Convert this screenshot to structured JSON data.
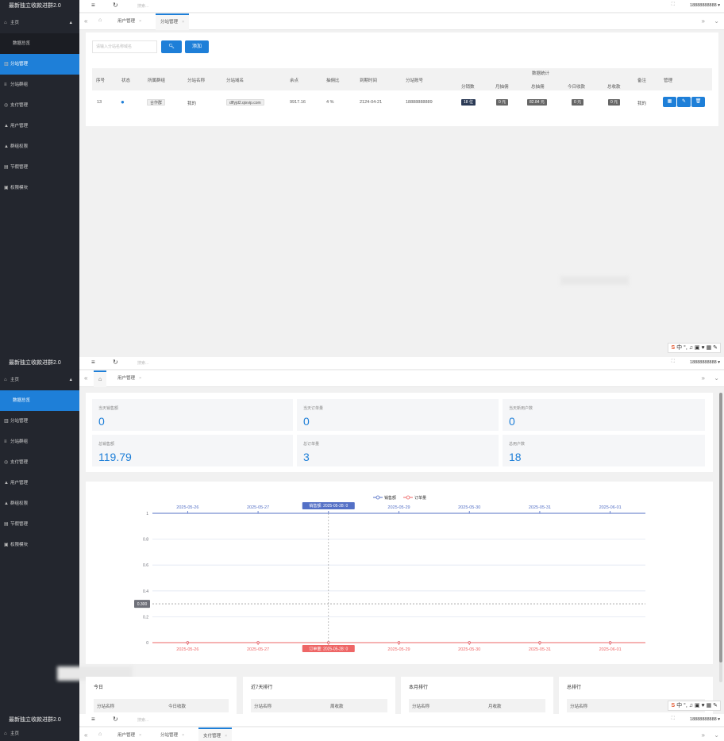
{
  "app": {
    "brand": "最新独立收款进群2.0",
    "search_placeholder": "搜索...",
    "user": "18888888888",
    "menu": [
      "主页",
      "数据总览",
      "分站管理",
      "分站群组",
      "支付管理",
      "用户管理",
      "群组权限",
      "节假管理",
      "权限模块"
    ]
  },
  "screen1": {
    "tabs": [
      "用户管理",
      "分站管理"
    ],
    "search_placeholder": "请输入分站名称域名",
    "add_label": "添加",
    "headers": {
      "seq": "序号",
      "status": "状态",
      "group": "所属群组",
      "name": "分站名称",
      "domain": "分站域名",
      "points": "余点",
      "ratio": "抽佣比",
      "expire": "到期时间",
      "account": "分站账号",
      "stats": "数据统计",
      "sub_count": "分销数",
      "monthly": "月抽佣",
      "total_comm": "总抽佣",
      "today_income": "今日收款",
      "total_income": "总收款",
      "remark": "备注",
      "manage": "管理"
    },
    "row": {
      "seq": "13",
      "group": "合作群",
      "name": "我的",
      "domain": "dffyjd2.qixvip.com",
      "points": "9917.16",
      "ratio": "4 %",
      "expire": "2124-04-21",
      "account": "18888888889",
      "sub_count": "18 位",
      "monthly": "0 元",
      "total_comm": "82.84 元",
      "today_income": "0 元",
      "total_income": "0 元",
      "remark": "我的"
    }
  },
  "screen2": {
    "tabs": [
      "用户管理"
    ],
    "stats": [
      {
        "label": "当天销售额",
        "value": "0"
      },
      {
        "label": "当天订单量",
        "value": "0"
      },
      {
        "label": "当天新用户数",
        "value": "0"
      },
      {
        "label": "总销售额",
        "value": "119.79"
      },
      {
        "label": "总订单量",
        "value": "3"
      },
      {
        "label": "总用户数",
        "value": "18"
      }
    ],
    "ranks": [
      {
        "title": "今日",
        "c1": "分站名称",
        "c2": "今日收款"
      },
      {
        "title": "近7天排行",
        "c1": "分站名称",
        "c2": "周收款"
      },
      {
        "title": "本月排行",
        "c1": "分站名称",
        "c2": "月收款"
      },
      {
        "title": "总排行",
        "c1": "分站名称",
        "c2": ""
      }
    ],
    "tooltip_top": "销售额: 2025-05-28: 0",
    "tooltip_bottom": "订单量: 2025-05-28: 0",
    "cursor_value": "0.300"
  },
  "screen3": {
    "tabs": [
      "用户管理",
      "分站管理",
      "支付管理"
    ]
  },
  "ime": {
    "s": "S",
    "zh": "中",
    "dots": "°, ♫ ▣ ♥ ▦ ✎"
  },
  "chart_data": {
    "type": "line",
    "x": [
      "2025-05-26",
      "2025-05-27",
      "2025-05-28",
      "2025-05-29",
      "2025-05-30",
      "2025-05-31",
      "2025-06-01"
    ],
    "series": [
      {
        "name": "销售额",
        "values": [
          0,
          0,
          0,
          0,
          0,
          0,
          0
        ],
        "color": "#5470c6"
      },
      {
        "name": "订单量",
        "values": [
          0,
          0,
          0,
          0,
          0,
          0,
          0
        ],
        "color": "#ee6666"
      }
    ],
    "ylim": [
      0,
      1
    ],
    "yticks": [
      "0",
      "0.2",
      "0.4",
      "0.6",
      "0.8",
      "1"
    ],
    "legend": "top-center"
  }
}
